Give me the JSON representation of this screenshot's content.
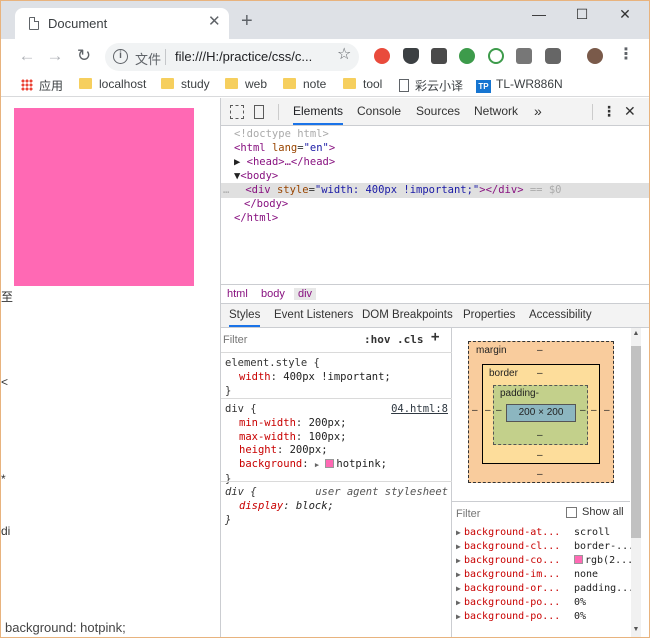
{
  "browser": {
    "tab_title": "Document",
    "tab_close": "✕",
    "new_tab": "+",
    "window_controls": {
      "minimize": "—",
      "maximize": "☐",
      "close": "✕"
    },
    "omnibox": {
      "label": "文件",
      "url": "file:///H:/practice/css/c..."
    },
    "bookmarks": [
      {
        "label": "应用",
        "icon": "apps-grid-icon"
      },
      {
        "label": "localhost",
        "icon": "folder-icon"
      },
      {
        "label": "study",
        "icon": "folder-icon"
      },
      {
        "label": "web",
        "icon": "folder-icon"
      },
      {
        "label": "note",
        "icon": "folder-icon"
      },
      {
        "label": "tool",
        "icon": "folder-icon"
      },
      {
        "label": "彩云小译",
        "icon": "page-icon"
      },
      {
        "label": "TL-WR886N",
        "icon": "tp-link-icon",
        "badge": "TP"
      }
    ]
  },
  "page": {
    "bottom_text": "background: hotpink;",
    "box_color": "#ff69b4"
  },
  "devtools": {
    "tabs": [
      "Elements",
      "Console",
      "Sources",
      "Network"
    ],
    "more_tabs": "»",
    "dom": {
      "doctype": "<!doctype html>",
      "html_open_tag": "<html",
      "html_lang_attr": "lang",
      "html_lang_val": "\"en\"",
      "head": "<head>…</head>",
      "body_open": "<body>",
      "div_open": "<div",
      "div_style_attr": "style",
      "div_style_val": "\"width: 400px !important;\"",
      "div_close": "></div>",
      "selected_marker": " == $0",
      "ellipsis": "…",
      "body_close": "</body>",
      "html_close": "</html>"
    },
    "breadcrumbs": [
      "html",
      "body",
      "div"
    ],
    "subtabs": [
      "Styles",
      "Event Listeners",
      "DOM Breakpoints",
      "Properties",
      "Accessibility"
    ],
    "styles": {
      "filter_placeholder": "Filter",
      "hov": ":hov",
      "cls": ".cls",
      "add": "+",
      "rules": [
        {
          "selector": "element.style {",
          "props": [
            {
              "name": "width",
              "value": "400px !important;"
            }
          ],
          "close": "}"
        },
        {
          "selector": "div {",
          "source": "04.html:8",
          "props": [
            {
              "name": "min-width",
              "value": "200px;"
            },
            {
              "name": "max-width",
              "value": "100px;"
            },
            {
              "name": "height",
              "value": "200px;"
            },
            {
              "name": "background",
              "value": "hotpink;"
            }
          ],
          "close": "}"
        },
        {
          "selector": "div {",
          "source": "user agent stylesheet",
          "props": [
            {
              "name": "display",
              "value": "block;"
            }
          ],
          "close": "}"
        }
      ]
    },
    "box_model": {
      "margin": "margin",
      "border": "border",
      "padding": "padding-",
      "content": "200 × 200",
      "dash": "–"
    },
    "computed": {
      "filter_placeholder": "Filter",
      "show_all": "Show all",
      "rows": [
        {
          "name": "background-at...",
          "value": "scroll"
        },
        {
          "name": "background-cl...",
          "value": "border-..."
        },
        {
          "name": "background-co...",
          "value": "rgb(2..."
        },
        {
          "name": "background-im...",
          "value": "none"
        },
        {
          "name": "background-or...",
          "value": "padding..."
        },
        {
          "name": "background-po...",
          "value": "0%"
        },
        {
          "name": "background-po...",
          "value": "0%"
        }
      ]
    }
  }
}
